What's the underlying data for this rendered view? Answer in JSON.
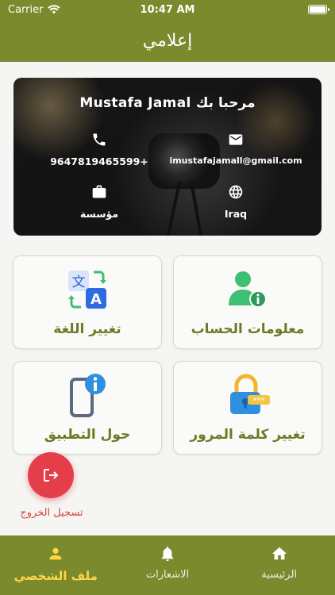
{
  "status_bar": {
    "carrier": "Carrier",
    "time": "10:47 AM"
  },
  "header": {
    "title": "إعلامي"
  },
  "profile": {
    "greeting": "Mustafa Jamal مرحبا بك",
    "phone": "9647819465599+",
    "email": "imustafajamall@gmail.com",
    "organization": "مؤسسة",
    "country": "Iraq"
  },
  "tiles": {
    "account_info": "معلومات الحساب",
    "change_language": "تغيير اللغة",
    "change_password": "تغيير كلمة المرور",
    "about_app": "حول التطبيق"
  },
  "logout": {
    "label": "تسجيل الخروج"
  },
  "bottom_nav": {
    "home": "الرئيسية",
    "notifications": "الاشعارات",
    "profile": "ملف الشخصي"
  },
  "colors": {
    "primary": "#7a8a2c",
    "accent": "#ffd64a",
    "danger": "#e53e4b"
  }
}
